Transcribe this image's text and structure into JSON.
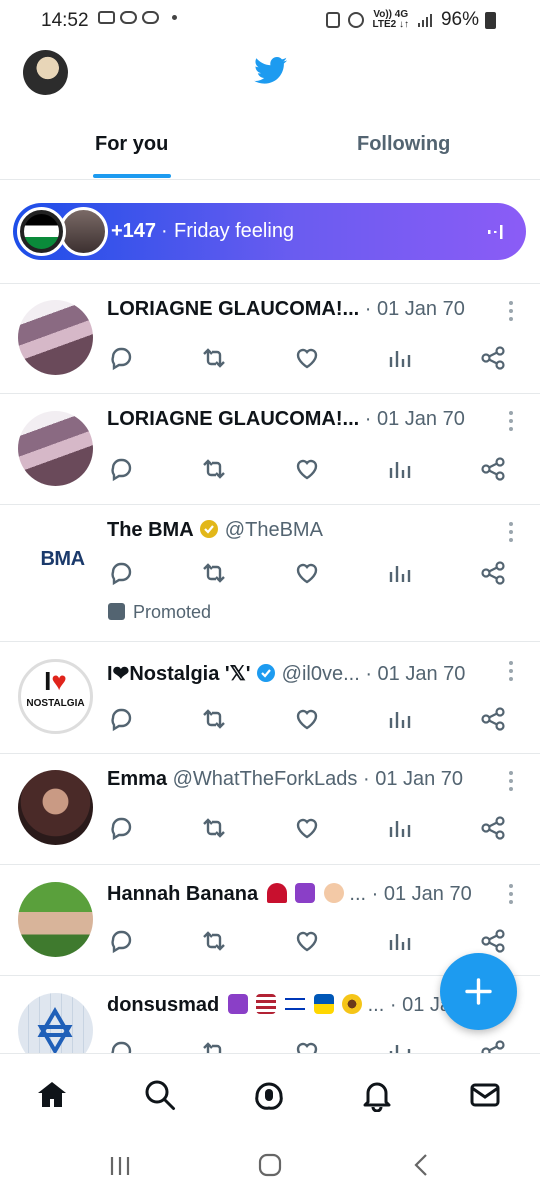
{
  "status_bar": {
    "time": "14:52",
    "net_top": "Vo)) 4G",
    "net_bottom": "LTE2 ↓↑",
    "battery": "96%"
  },
  "header": {
    "tabs": [
      "For you",
      "Following"
    ],
    "active_tab": "For you"
  },
  "spaces_banner": {
    "count": "+147",
    "separator": "·",
    "title": "Friday feeling"
  },
  "tweets": [
    {
      "name": "LORIAGNE GLAUCOMA!...",
      "handle": "",
      "date": "· 01 Jan 70"
    },
    {
      "name": "LORIAGNE GLAUCOMA!...",
      "handle": "",
      "date": "· 01 Jan 70"
    },
    {
      "name": "The BMA",
      "handle": "@TheBMA",
      "date": "",
      "promoted": "Promoted",
      "avatar_text": "BMA"
    },
    {
      "name": "I❤Nostalgia '𝕏'",
      "handle": "@il0ve...",
      "date": "· 01 Jan 70",
      "avatar_text_1": "I",
      "avatar_text_2": "NOSTALGIA"
    },
    {
      "name": "Emma",
      "handle": "@WhatTheForkLads",
      "date": "· 01 Jan 70"
    },
    {
      "name": "Hannah Banana",
      "handle": "...",
      "date": "· 01 Jan 70"
    },
    {
      "name": "donsusmad",
      "handle": "...",
      "date": "· 01 Jan 70"
    }
  ],
  "colors": {
    "accent": "#1d9bf0",
    "text_secondary": "#536471",
    "verified_gold": "#e2b719"
  },
  "icons": {
    "actions": [
      "reply-icon",
      "retweet-icon",
      "like-icon",
      "views-icon",
      "share-icon"
    ],
    "bottom_nav": [
      "home-icon",
      "search-icon",
      "spaces-icon",
      "notifications-icon",
      "messages-icon"
    ]
  }
}
